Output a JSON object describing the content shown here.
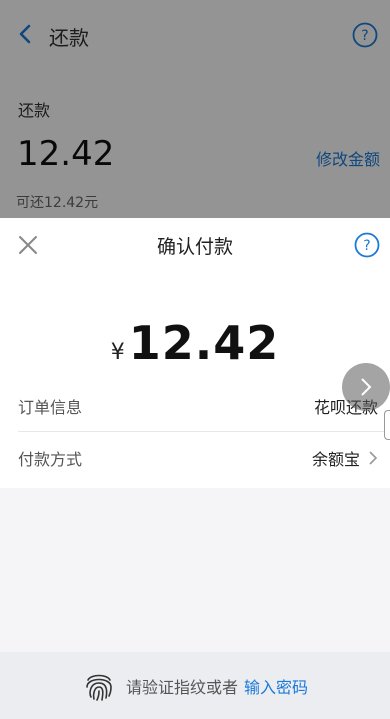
{
  "header": {
    "title": "还款"
  },
  "repay": {
    "label": "还款",
    "amount": "12.42",
    "modify_link": "修改金额",
    "hint": "可还12.42元"
  },
  "sheet": {
    "title": "确认付款",
    "currency": "¥",
    "amount": "12.42",
    "rows": [
      {
        "label": "订单信息",
        "value": "花呗还款"
      },
      {
        "label": "付款方式",
        "value": "余额宝"
      }
    ],
    "footer_text": "请验证指纹或者",
    "footer_link": "输入密码"
  },
  "colors": {
    "accent": "#1a7ad9",
    "overlay": "rgba(0,0,0,0.42)"
  }
}
